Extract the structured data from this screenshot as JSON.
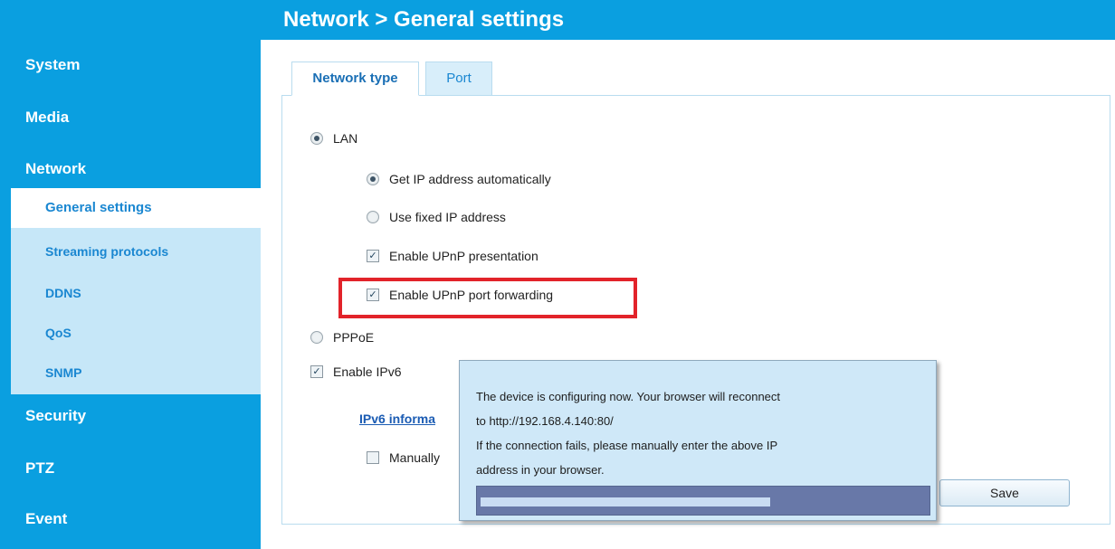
{
  "header": {
    "title": "Network  > General settings"
  },
  "sidebar": {
    "items": [
      {
        "label": "System"
      },
      {
        "label": "Media"
      },
      {
        "label": "Network"
      },
      {
        "label": "Security"
      },
      {
        "label": "PTZ"
      },
      {
        "label": "Event"
      }
    ],
    "network_sub": [
      {
        "label": "General settings",
        "active": true
      },
      {
        "label": "Streaming protocols"
      },
      {
        "label": "DDNS"
      },
      {
        "label": "QoS"
      },
      {
        "label": "SNMP"
      }
    ]
  },
  "tabs": [
    {
      "label": "Network type",
      "active": true
    },
    {
      "label": "Port"
    }
  ],
  "form": {
    "lan_label": "LAN",
    "get_ip_auto_label": "Get IP address automatically",
    "use_fixed_ip_label": "Use fixed IP address",
    "enable_upnp_presentation_label": "Enable UPnP presentation",
    "enable_upnp_port_forwarding_label": "Enable UPnP port forwarding",
    "pppoe_label": "PPPoE",
    "enable_ipv6_label": "Enable IPv6",
    "ipv6_info_link": "IPv6 informa",
    "manually_label": "Manually",
    "save_label": "Save"
  },
  "dialog": {
    "line1": "The device is configuring now. Your browser will reconnect",
    "line2": "to http://192.168.4.140:80/",
    "line3": "If the connection fails, please manually enter the above IP",
    "line4": "address in your browser.",
    "progress": 0.65
  },
  "colors": {
    "brand_blue": "#0a9fe0",
    "highlight_red": "#e2232a"
  }
}
